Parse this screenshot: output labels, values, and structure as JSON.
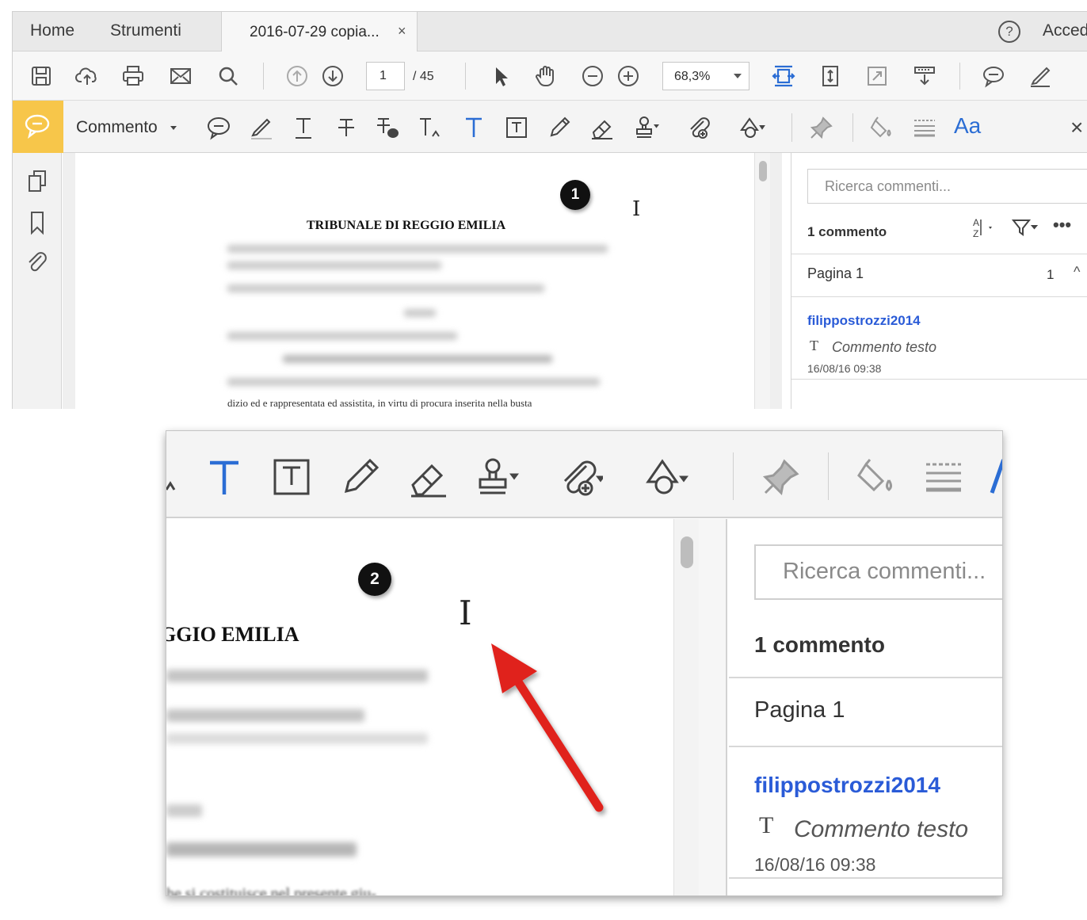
{
  "tabs": {
    "home": "Home",
    "tools": "Strumenti",
    "document": "2016-07-29 copia...",
    "close": "×",
    "help": "?",
    "signin": "Accedi"
  },
  "toolbar": {
    "page_current": "1",
    "page_total": "/ 45",
    "zoom": "68,3%"
  },
  "comment_toolbar": {
    "label": "Commento",
    "text_format": "Aa",
    "close": "×"
  },
  "document": {
    "title": "TRIBUNALE DI REGGIO EMILIA",
    "last_line": "dizio ed e rappresentata ed assistita, in virtu di procura inserita nella busta"
  },
  "comments_panel": {
    "search_placeholder": "Ricerca commenti...",
    "count_label": "1 commento",
    "page_group": "Pagina 1",
    "page_group_count": "1",
    "comment": {
      "author": "filippostrozzi2014",
      "type_icon": "T",
      "text": "Commento testo",
      "date": "16/08/16  09:38"
    }
  },
  "callouts": {
    "step1": "1",
    "step2": "2"
  },
  "zoom_view": {
    "title_fragment": "GGIO EMILIA",
    "bottom_fragment": "he si costituisce nel presente giu-"
  },
  "colors": {
    "accent_yellow": "#f7c64a",
    "link_blue": "#2a5bd7",
    "tool_blue": "#2b6dd4",
    "arrow_red": "#e0201c"
  }
}
